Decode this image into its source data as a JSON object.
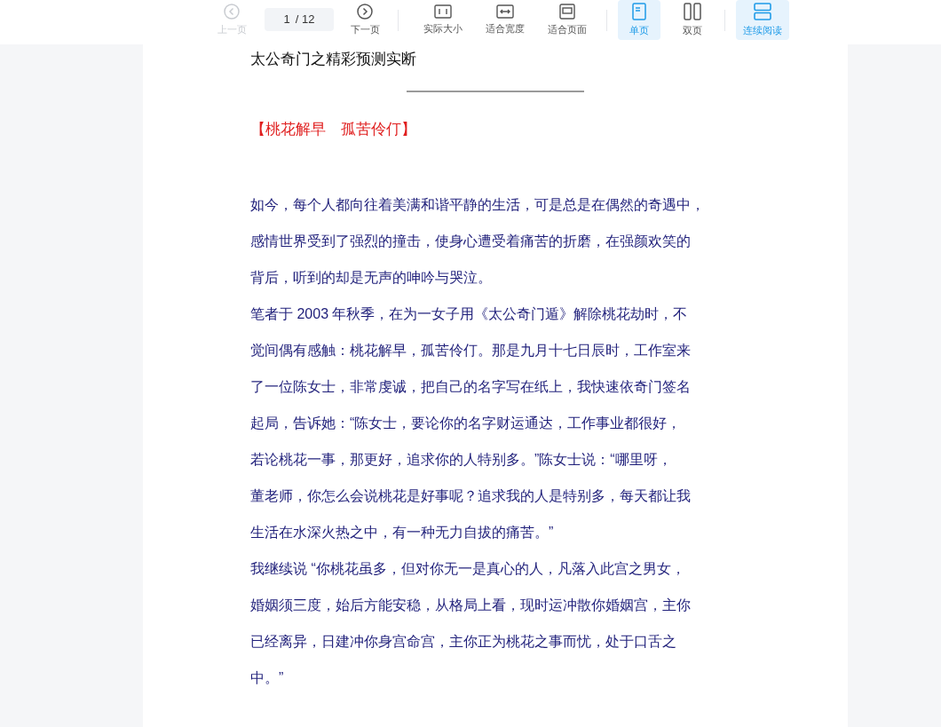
{
  "toolbar": {
    "nav": [
      {
        "label": "上一页",
        "disabled": true
      },
      {
        "label": "下一页",
        "disabled": false
      }
    ],
    "page_field": {
      "value": "1",
      "total": "/ 12"
    },
    "zoom": [
      "实际大小",
      "适合宽度",
      "适合页面"
    ],
    "view_modes": [
      {
        "label": "单页",
        "selected": true
      },
      {
        "label": "双页",
        "selected": false
      }
    ],
    "reading_mode": {
      "label": "连续阅读",
      "selected": true
    }
  },
  "document": {
    "title": "太公奇门之精彩预测实断",
    "subtitle": "【桃花解早　孤苦伶仃】",
    "paragraphs": [
      [
        "如今，每个人都向往着美满和谐平静的生活，可是总是在偶然的奇遇中，",
        "感情世界受到了强烈的撞击，使身心遭受着痛苦的折磨，在强颜欢笑的",
        "背后，听到的却是无声的呻吟与哭泣。"
      ],
      [
        "笔者于 2003 年秋季，在为一女子用《太公奇门遁》解除桃花劫时，不",
        "觉间偶有感触：桃花解早，孤苦伶仃。那是九月十七日辰时，工作室来",
        "了一位陈女士，非常虔诚，把自己的名字写在纸上，我快速依奇门签名",
        "起局，告诉她：“陈女士，要论你的名字财运通达，工作事业都很好，",
        "若论桃花一事，那更好，追求你的人特别多。”陈女士说：“哪里呀，",
        "董老师，你怎么会说桃花是好事呢？追求我的人是特别多，每天都让我",
        "生活在水深火热之中，有一种无力自拔的痛苦。”"
      ],
      [
        "我继续说 “你桃花虽多，但对你无一是真心的人，凡落入此宫之男女，",
        "婚姻须三度，始后方能安稳，从格局上看，现时运冲散你婚姻宫，主你",
        "已经离异，日建冲你身宫命宫，主你正为桃花之事而忧，处于口舌之",
        "中。”"
      ]
    ]
  }
}
